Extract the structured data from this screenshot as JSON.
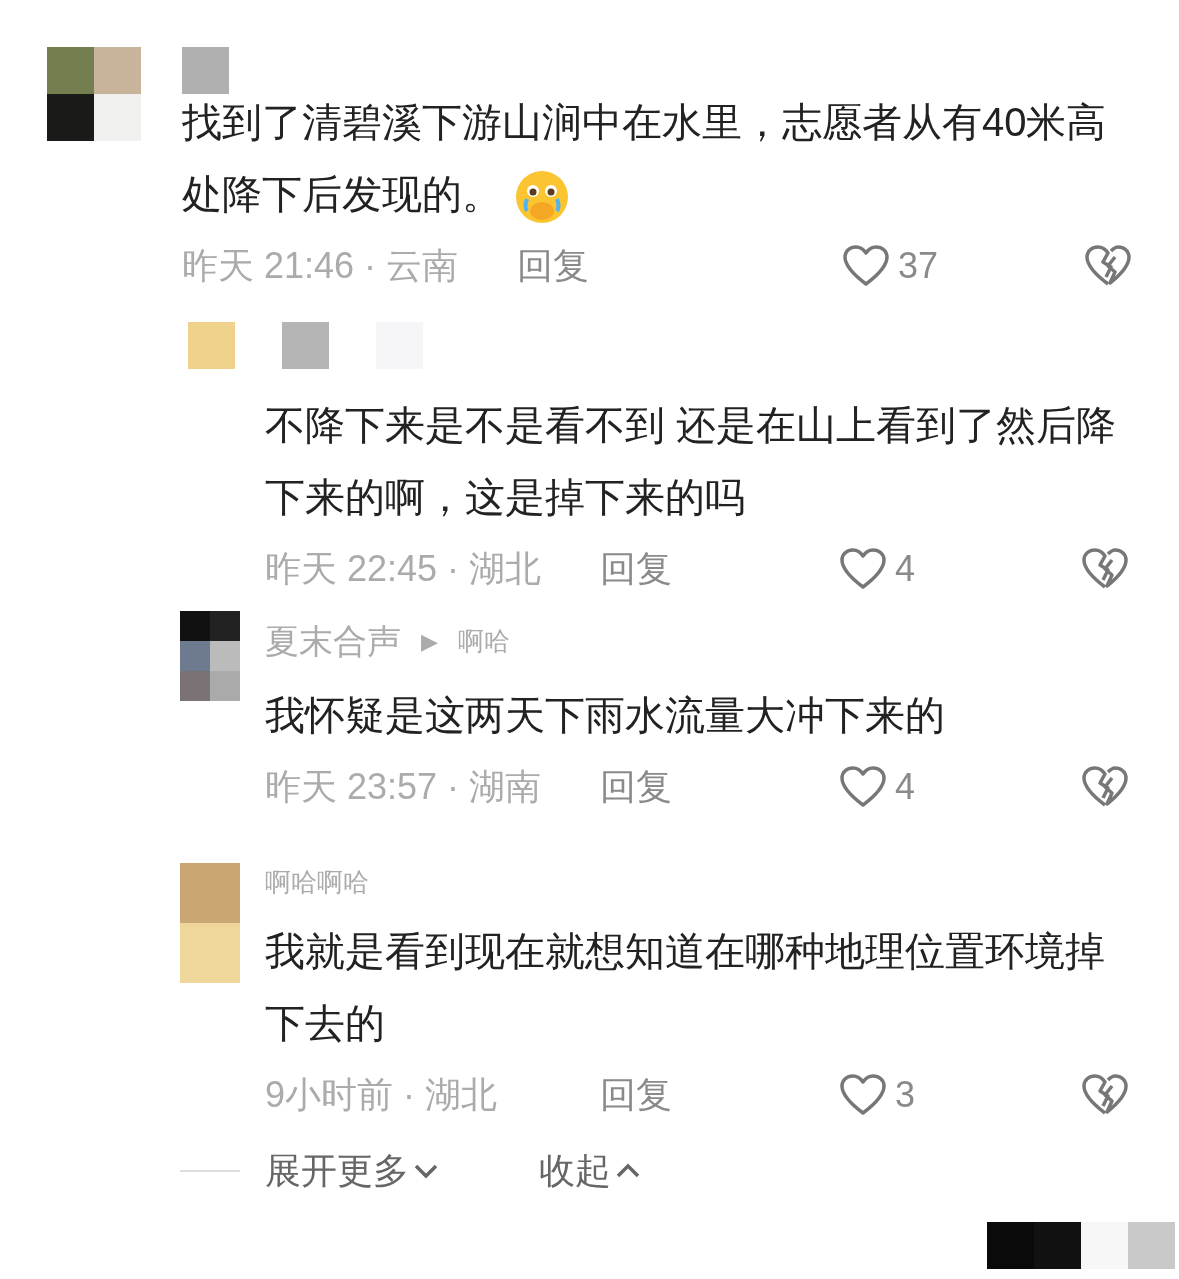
{
  "comment": {
    "text": "找到了清碧溪下游山涧中在水里，志愿者从有40米高处降下后发现的。",
    "time": "昨天 21:46 · 云南",
    "reply_label": "回复",
    "likes": "37"
  },
  "replies": [
    {
      "text": "不降下来是不是看不到 还是在山上看到了然后降下来的啊，这是掉下来的吗",
      "time": "昨天 22:45 · 湖北",
      "reply_label": "回复",
      "likes": "4"
    },
    {
      "author": "夏末合声",
      "arrow": "▶",
      "reply_to": "啊哈",
      "text": "我怀疑是这两天下雨水流量大冲下来的",
      "time": "昨天 23:57 · 湖南",
      "reply_label": "回复",
      "likes": "4"
    },
    {
      "author": "啊哈啊哈",
      "text": "我就是看到现在就想知道在哪种地理位置环境掉下去的",
      "time": "9小时前 · 湖北",
      "reply_label": "回复",
      "likes": "3"
    }
  ],
  "footer": {
    "expand": "展开更多",
    "collapse": "收起"
  }
}
